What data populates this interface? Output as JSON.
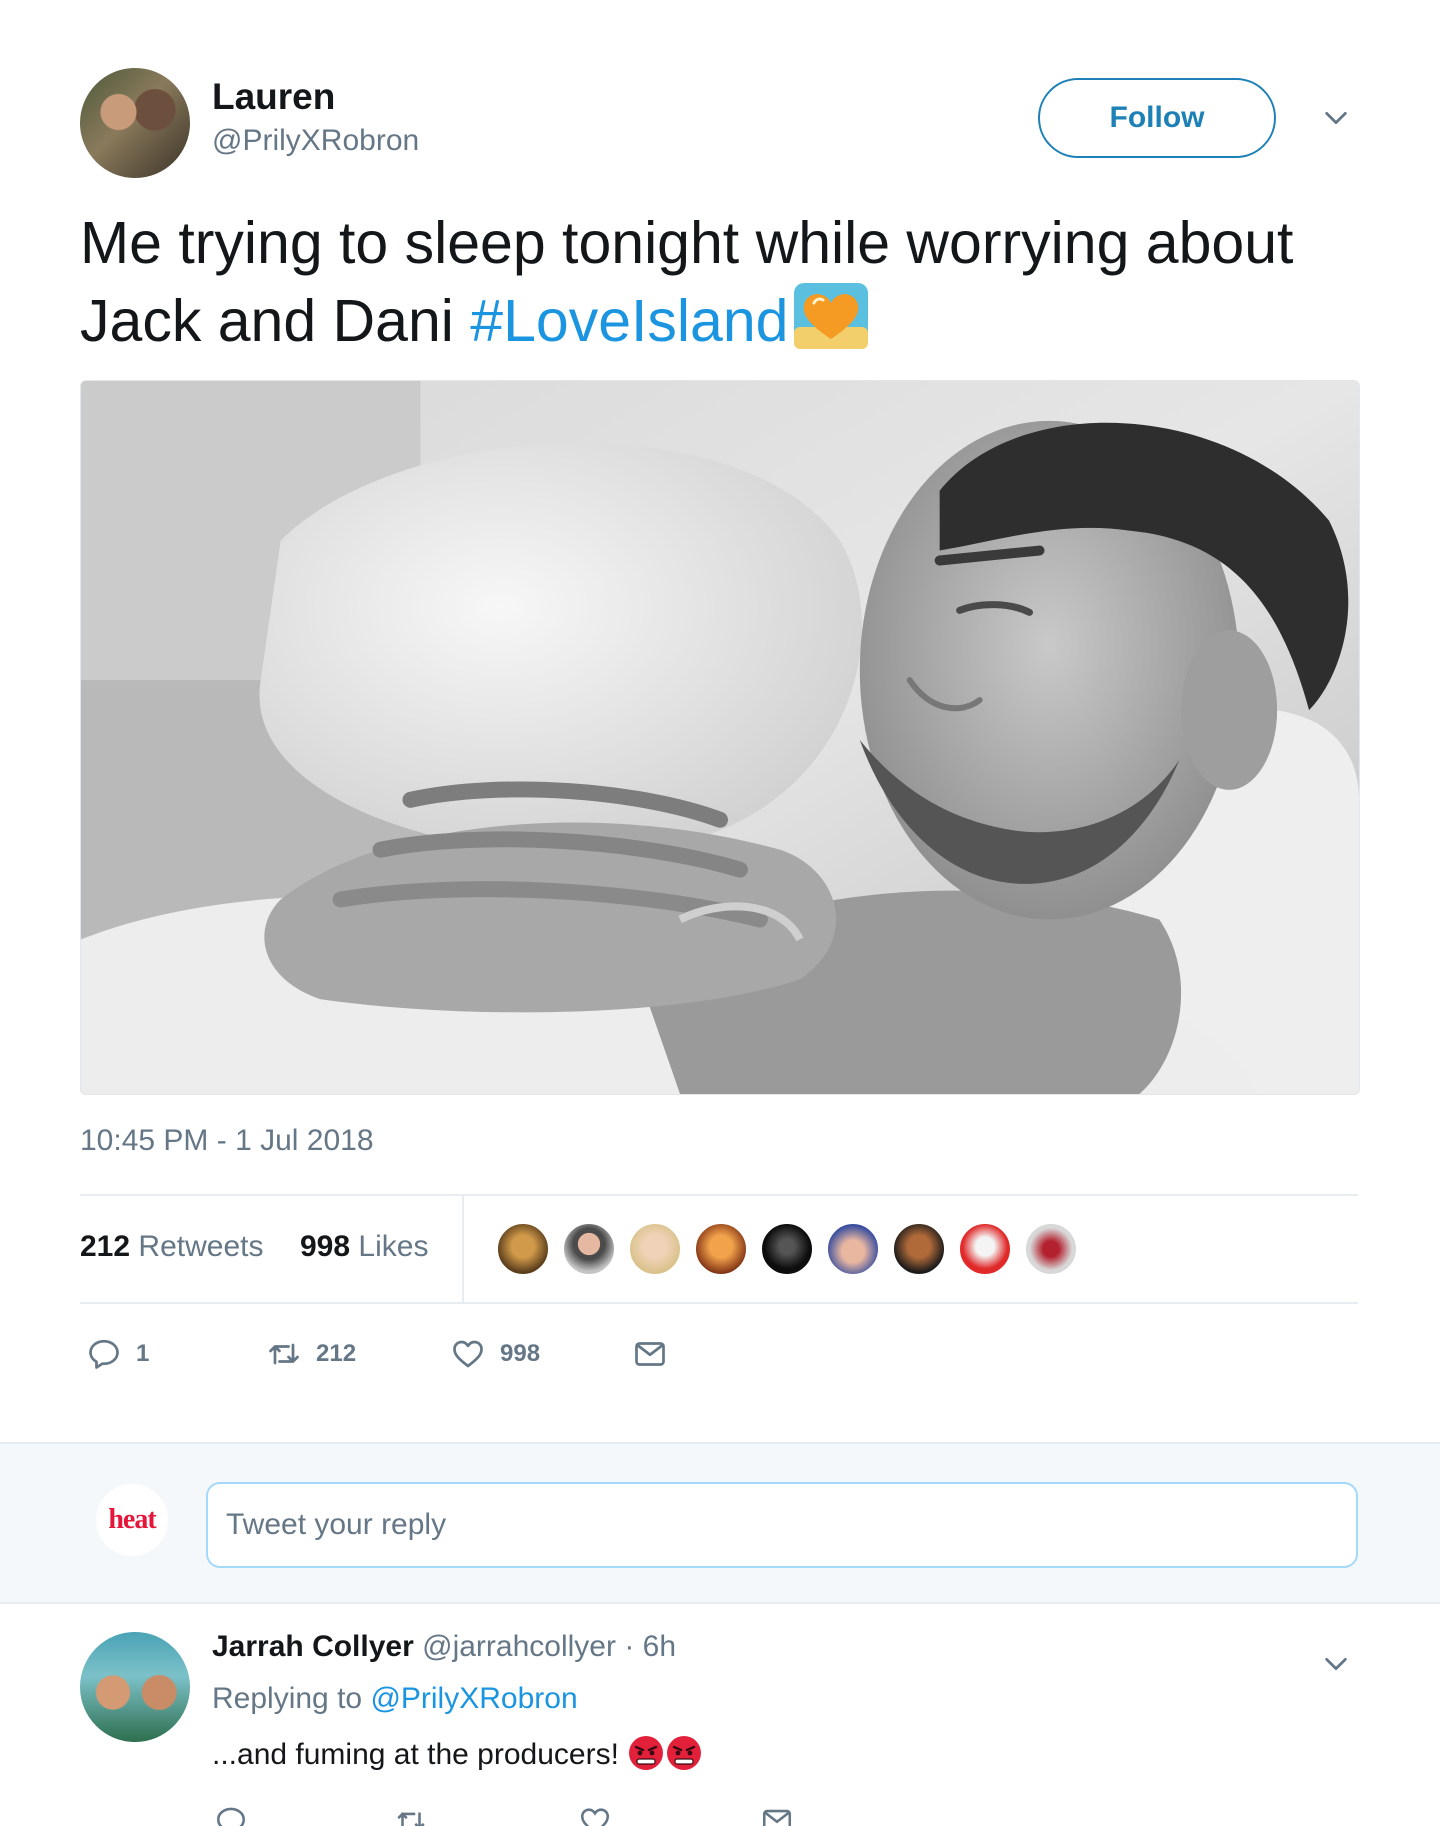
{
  "tweet": {
    "author_name": "Lauren",
    "author_handle": "@PrilyXRobron",
    "follow_label": "Follow",
    "text_main": "Me trying to sleep tonight while worrying about Jack and Dani ",
    "hashtag": "#LoveIsland",
    "timestamp": "10:45 PM - 1 Jul 2018",
    "retweets_count": "212",
    "retweets_label": "Retweets",
    "likes_count": "998",
    "likes_label": "Likes",
    "likers_count_shown": 9,
    "actions": {
      "reply_count": "1",
      "retweet_count": "212",
      "like_count": "998"
    },
    "icons": [
      "reply-icon",
      "retweet-icon",
      "like-icon",
      "direct-message-icon",
      "chevron-down-icon",
      "heart-emoji"
    ]
  },
  "reply_box": {
    "logo_text": "heat",
    "placeholder": "Tweet your reply"
  },
  "reply": {
    "author_name": "Jarrah Collyer",
    "author_handle": "@jarrahcollyer",
    "time": "· 6h",
    "replying_to_label": "Replying to",
    "replying_to_handle": "@PrilyXRobron",
    "text": "...and fuming at the producers!",
    "emoji": "angry-face-emoji"
  },
  "colors": {
    "link": "#1b95e0",
    "follow": "#1d81b8",
    "secondary_text": "#657786",
    "border": "#e6ecf0",
    "heat_brand": "#e4173b"
  }
}
